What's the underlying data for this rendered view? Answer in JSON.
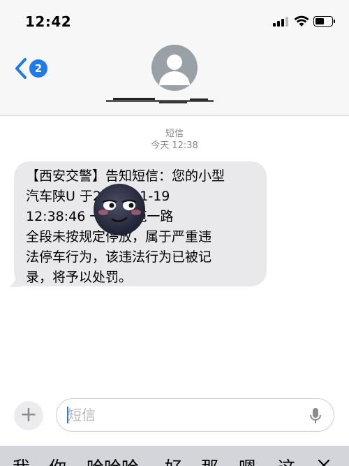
{
  "status_bar": {
    "time": "12:42"
  },
  "header": {
    "unread_count": "2"
  },
  "thread": {
    "service_label": "短信",
    "timestamp": "今天 12:38",
    "message_lines": [
      "【西安交警】告知短信：您的小型",
      "汽车陕U     于2024-01-19",
      "12:38:46     一路,秦苑一路",
      "全段未按规定停放，属于严重违",
      "法停车行为，该违法行为已被记",
      "录，将予以处罚。"
    ]
  },
  "compose": {
    "plus_label": "+",
    "placeholder": "短信"
  },
  "keyboard": {
    "suggestions": [
      "我",
      "你",
      "哈哈哈",
      "好",
      "那",
      "嗯",
      "这"
    ]
  },
  "colors": {
    "accent": "#1f7aea",
    "bubble": "#e9e9eb",
    "header_bg": "#f7f7f7"
  }
}
